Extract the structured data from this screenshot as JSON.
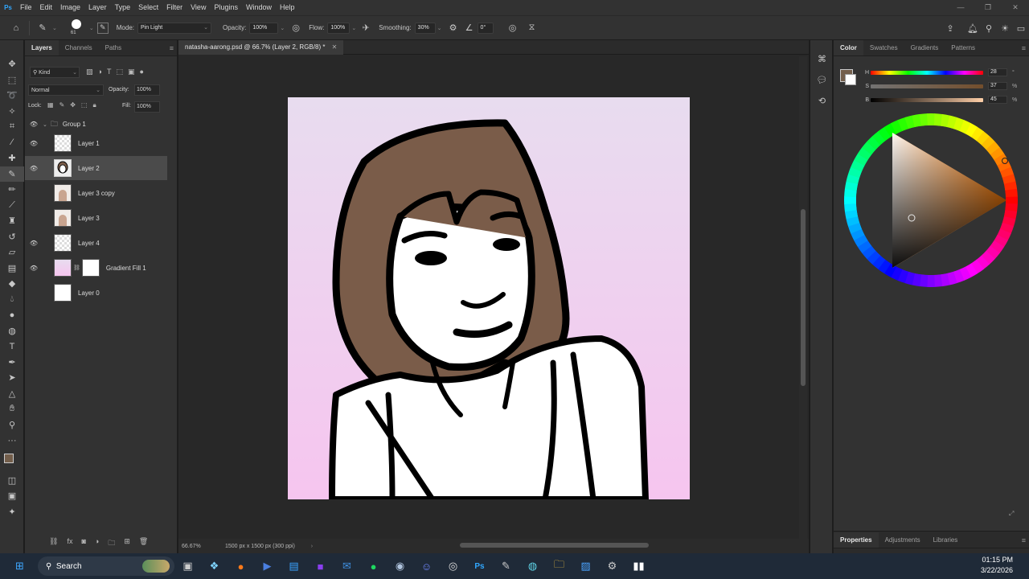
{
  "menubar": {
    "logo": "Ps",
    "items": [
      "File",
      "Edit",
      "Image",
      "Layer",
      "Type",
      "Select",
      "Filter",
      "View",
      "Plugins",
      "Window",
      "Help"
    ]
  },
  "options": {
    "brush_size": "61",
    "mode_label": "Mode:",
    "mode_value": "Pin Light",
    "opacity_label": "Opacity:",
    "opacity_value": "100%",
    "flow_label": "Flow:",
    "flow_value": "100%",
    "smoothing_label": "Smoothing:",
    "smoothing_value": "30%",
    "angle_value": "0°"
  },
  "layers_panel": {
    "tabs": [
      "Layers",
      "Channels",
      "Paths"
    ],
    "filter_kind": "Kind",
    "blend_mode": "Normal",
    "opacity_label": "Opacity:",
    "opacity_value": "100%",
    "lock_label": "Lock:",
    "fill_label": "Fill:",
    "fill_value": "100%",
    "layers": [
      {
        "name": "Group 1",
        "visible": true
      },
      {
        "name": "Layer 1",
        "visible": true
      },
      {
        "name": "Layer 2",
        "visible": true,
        "selected": true
      },
      {
        "name": "Layer 3 copy",
        "visible": false
      },
      {
        "name": "Layer 3",
        "visible": false
      },
      {
        "name": "Layer 4",
        "visible": true
      },
      {
        "name": "Gradient Fill 1",
        "visible": true
      },
      {
        "name": "Layer 0",
        "visible": false
      }
    ]
  },
  "document": {
    "tab_title": "natasha-aarong.psd @ 66.7% (Layer 2, RGB/8) *",
    "zoom": "66.67%",
    "doc_info": "1500 px x 1500 px (300 ppi)",
    "hair_color": "#7a5c49",
    "bg_top_color": "#e8dcef",
    "bg_bottom_color": "#f6c5ef"
  },
  "color_panel": {
    "tabs": [
      "Color",
      "Swatches",
      "Gradients",
      "Patterns"
    ],
    "h_label": "H",
    "h_value": "28",
    "h_unit": "°",
    "s_label": "S",
    "s_value": "37",
    "s_unit": "%",
    "b_label": "B",
    "b_value": "45",
    "b_unit": "%",
    "foreground_color": "#735e4b"
  },
  "properties_panel": {
    "tabs": [
      "Properties",
      "Adjustments",
      "Libraries"
    ]
  },
  "taskbar": {
    "search_label": "Search",
    "time": "01:15 PM",
    "date": "3/22/2026"
  }
}
